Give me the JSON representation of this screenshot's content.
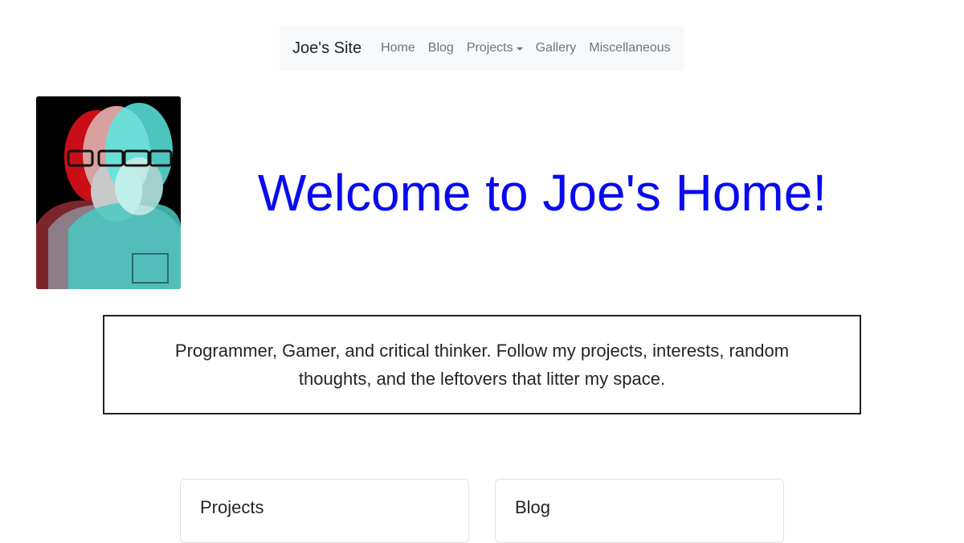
{
  "navbar": {
    "brand": "Joe's Site",
    "links": [
      {
        "label": "Home"
      },
      {
        "label": "Blog"
      },
      {
        "label": "Projects"
      },
      {
        "label": "Gallery"
      },
      {
        "label": "Miscellaneous"
      }
    ]
  },
  "hero": {
    "title": "Welcome to Joe's Home!",
    "title_color": "#0a0af0",
    "portrait_icon": "portrait-photo-icon"
  },
  "tagline": {
    "text": "Programmer, Gamer, and critical thinker. Follow my projects, interests, random thoughts, and the leftovers that litter my space."
  },
  "cards": [
    {
      "title": "Projects"
    },
    {
      "title": "Blog"
    }
  ],
  "colors": {
    "navbar_bg": "#f8f9fa",
    "nav_link": "#6c757d",
    "text": "#212529"
  }
}
